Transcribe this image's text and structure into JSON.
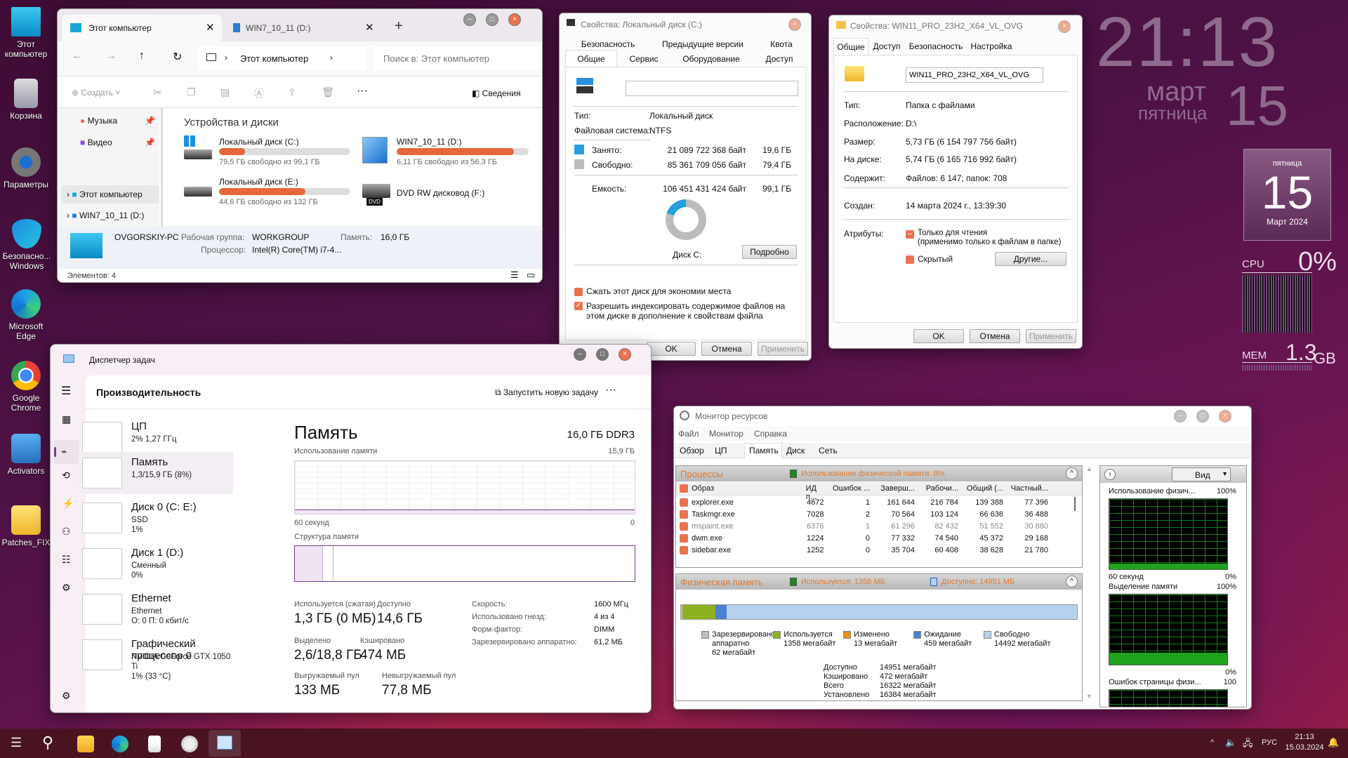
{
  "desktop": {
    "icons": [
      "Этот компьютер",
      "Корзина",
      "Параметры",
      "Безопасно... Windows",
      "Microsoft Edge",
      "Google Chrome",
      "Activators",
      "Patches_FIX"
    ]
  },
  "clock_widget": {
    "time": "21:13",
    "month": "март",
    "weekday": "пятница",
    "day": "15"
  },
  "calendar_gadget": {
    "weekday": "пятница",
    "day": "15",
    "month_year": "Март 2024"
  },
  "cpu_meter": {
    "label": "CPU",
    "value": "0%",
    "level_percent": 0
  },
  "mem_meter": {
    "label": "MEM",
    "value": "1.3",
    "unit": "GB"
  },
  "explorer": {
    "tabs": [
      {
        "label": "Этот компьютер"
      },
      {
        "label": "WIN7_10_11 (D:)"
      }
    ],
    "address": "Этот компьютер",
    "search_placeholder": "Поиск в: Этот компьютер",
    "toolbar": {
      "create": "Создать",
      "details": "Сведения"
    },
    "nav": [
      "Музыка",
      "Видео",
      "Этот компьютер",
      "WIN7_10_11 (D:)"
    ],
    "section": "Устройства и диски",
    "drives": [
      {
        "name": "Локальный диск (C:)",
        "free": "79,5 ГБ свободно из 99,1 ГБ",
        "used_percent": 20
      },
      {
        "name": "WIN7_10_11 (D:)",
        "free": "6,11 ГБ свободно из 56,3 ГБ",
        "used_percent": 89
      },
      {
        "name": "Локальный диск (E:)",
        "free": "44,6 ГБ свободно из 132 ГБ",
        "used_percent": 66
      },
      {
        "name": "DVD RW дисковод (F:)",
        "badge": "DVD"
      }
    ],
    "details": {
      "pc": "OVGORSKIY-PC",
      "wg_label": "Рабочая группа:",
      "wg": "WORKGROUP",
      "mem_label": "Память:",
      "mem": "16,0 ГБ",
      "cpu_label": "Процессор:",
      "cpu": "Intel(R) Core(TM) i7-4..."
    },
    "status": "Элементов: 4"
  },
  "disk_props": {
    "title": "Свойства: Локальный диск (C:)",
    "tabs_row1": [
      "Безопасность",
      "Предыдущие версии",
      "Квота"
    ],
    "tabs_row2": [
      "Общие",
      "Сервис",
      "Оборудование",
      "Доступ"
    ],
    "name_value": "",
    "type_label": "Тип:",
    "type": "Локальный диск",
    "fs_label": "Файловая система:",
    "fs": "NTFS",
    "used_label": "Занято:",
    "used_bytes": "21 089 722 368 байт",
    "used_gb": "19,6 ГБ",
    "free_label": "Свободно:",
    "free_bytes": "85 361 709 056 байт",
    "free_gb": "79,4 ГБ",
    "cap_label": "Емкость:",
    "cap_bytes": "106 451 431 424 байт",
    "cap_gb": "99,1 ГБ",
    "used_percent": 19.8,
    "disk_label": "Диск C:",
    "details_btn": "Подробно",
    "compress": "Сжать этот диск для экономии места",
    "index": "Разрешить индексировать содержимое файлов на этом диске в дополнение к свойствам файла",
    "ok": "OK",
    "cancel": "Отмена",
    "apply": "Применить",
    "colors": {
      "used": "#26a0da",
      "free": "#bcbcbc"
    }
  },
  "folder_props": {
    "title": "Свойства: WIN11_PRO_23H2_X64_VL_OVG",
    "tabs": [
      "Общие",
      "Доступ",
      "Безопасность",
      "Настройка"
    ],
    "name_value": "WIN11_PRO_23H2_X64_VL_OVG",
    "rows": [
      {
        "k": "Тип:",
        "v": "Папка с файлами"
      },
      {
        "k": "Расположение:",
        "v": "D:\\"
      },
      {
        "k": "Размер:",
        "v": "5,73 ГБ (6 154 797 756 байт)"
      },
      {
        "k": "На диске:",
        "v": "5,74 ГБ (6 165 716 992 байт)"
      },
      {
        "k": "Содержит:",
        "v": "Файлов: 6 147; папок: 708"
      },
      {
        "k": "Создан:",
        "v": "14 марта 2024 г., 13:39:30"
      }
    ],
    "attr_label": "Атрибуты:",
    "readonly": "Только для чтения",
    "readonly_note": "(применимо только к файлам в папке)",
    "hidden": "Скрытый",
    "other_btn": "Другие...",
    "ok": "OK",
    "cancel": "Отмена",
    "apply": "Применить"
  },
  "taskmgr": {
    "title": "Диспетчер задач",
    "page": "Производительность",
    "new_task": "Запустить новую задачу",
    "items": [
      {
        "t1": "ЦП",
        "t2": "2% 1,27 ГГц"
      },
      {
        "t1": "Память",
        "t2": "1,3/15,9 ГБ (8%)"
      },
      {
        "t1": "Диск 0 (C: E:)",
        "t2": "SSD",
        "t3": "1%"
      },
      {
        "t1": "Диск 1 (D:)",
        "t2": "Сменный",
        "t3": "0%"
      },
      {
        "t1": "Ethernet",
        "t2": "Ethernet",
        "t3": "О: 0 П: 0 кбит/с"
      },
      {
        "t1": "Графический процессор 0",
        "t2": "NVIDIA GeForce GTX 1050 Ti",
        "t3": "1% (33 °C)"
      }
    ],
    "heading": "Память",
    "spec": "16,0 ГБ DDR3",
    "usage_label": "Использование памяти",
    "usage_max": "15,9 ГБ",
    "axis_left": "60 секунд",
    "axis_right": "0",
    "structure_label": "Структура памяти",
    "stats": [
      {
        "k": "Используется (сжатая)",
        "v": "1,3 ГБ (0 МБ)"
      },
      {
        "k": "Доступно",
        "v": "14,6 ГБ"
      },
      {
        "k": "Выделено",
        "v": "2,6/18,8 ГБ"
      },
      {
        "k": "Кэшировано",
        "v": "474 МБ"
      },
      {
        "k": "Выгружаемый пул",
        "v": "133 МБ"
      },
      {
        "k": "Невыгружаемый пул",
        "v": "77,8 МБ"
      }
    ],
    "specs": [
      {
        "k": "Скорость:",
        "v": "1600 МГц"
      },
      {
        "k": "Использовано гнезд:",
        "v": "4 из 4"
      },
      {
        "k": "Форм-фактор:",
        "v": "DIMM"
      },
      {
        "k": "Зарезервировано аппаратно:",
        "v": "61,2 МБ"
      }
    ],
    "accent": "#7a3b8f"
  },
  "resmon": {
    "title": "Монитор ресурсов",
    "menu": [
      "Файл",
      "Монитор",
      "Справка"
    ],
    "tabs": [
      "Обзор",
      "ЦП",
      "Память",
      "Диск",
      "Сеть"
    ],
    "proc_title": "Процессы",
    "proc_usage": "Использование физической памяти: 8%",
    "columns": [
      "Образ",
      "ИД п...",
      "Ошибок ...",
      "Заверш...",
      "Рабочи...",
      "Общий (...",
      "Частный..."
    ],
    "rows": [
      [
        "explorer.exe",
        "4672",
        "1",
        "161 644",
        "216 784",
        "139 388",
        "77 396"
      ],
      [
        "Taskmgr.exe",
        "7028",
        "2",
        "70 564",
        "103 124",
        "66 636",
        "36 488"
      ],
      [
        "mspaint.exe",
        "6376",
        "1",
        "61 296",
        "82 432",
        "51 552",
        "30 880"
      ],
      [
        "dwm.exe",
        "1224",
        "0",
        "77 332",
        "74 540",
        "45 372",
        "29 168"
      ],
      [
        "sidebar.exe",
        "1252",
        "0",
        "35 704",
        "60 408",
        "38 628",
        "21 780"
      ]
    ],
    "phys_title": "Физическая память",
    "phys_used": "Используется: 1358 МБ",
    "phys_avail": "Доступно: 14951 МБ",
    "legend": [
      {
        "name": "Зарезервировано аппаратно",
        "value": "62 мегабайт",
        "color": "#bdbdbd"
      },
      {
        "name": "Используется",
        "value": "1358 мегабайт",
        "color": "#8db21d"
      },
      {
        "name": "Изменено",
        "value": "13 мегабайт",
        "color": "#e8900e"
      },
      {
        "name": "Ожидание",
        "value": "459 мегабайт",
        "color": "#4a82d4"
      },
      {
        "name": "Свободно",
        "value": "14492 мегабайт",
        "color": "#b6d0f0"
      }
    ],
    "totals": [
      {
        "k": "Доступно",
        "v": "14951 мегабайт"
      },
      {
        "k": "Кэшировано",
        "v": "472 мегабайт"
      },
      {
        "k": "Всего",
        "v": "16322 мегабайт"
      },
      {
        "k": "Установлено",
        "v": "16384 мегабайт"
      }
    ],
    "view_btn": "Вид",
    "graphs": [
      {
        "title": "Использование физич...",
        "max": "100%",
        "min": "0%",
        "left": "60 секунд"
      },
      {
        "title": "Выделение памяти",
        "max": "100%",
        "min": "0%"
      },
      {
        "title": "Ошибок страницы физи...",
        "max": "100"
      }
    ]
  },
  "taskbar": {
    "lang": "РУС",
    "time": "21:13",
    "date": "15.03.2024"
  }
}
